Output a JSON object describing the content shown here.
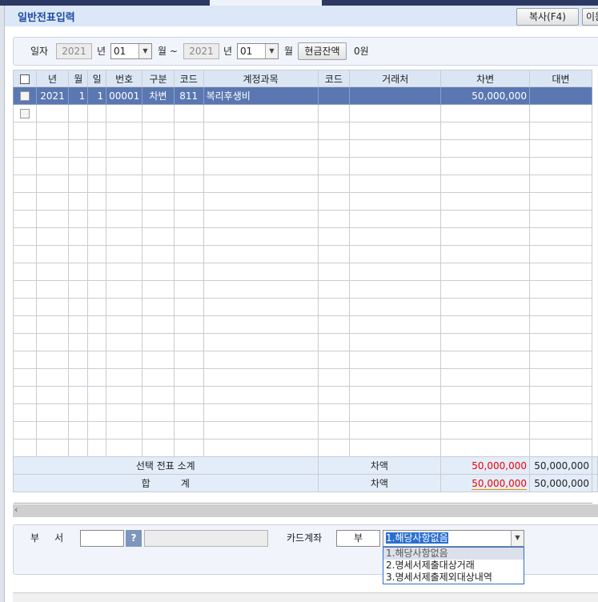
{
  "title": "일반전표입력",
  "toolbar": {
    "copy": "복사(F4)",
    "move": "이동"
  },
  "filter": {
    "date_label": "일자",
    "year_from": "2021",
    "year_unit": "년",
    "month_from": "01",
    "month_unit": "월 ~",
    "year_to": "2021",
    "month_to": "01",
    "month_unit2": "월",
    "cash_button": "현금잔액",
    "cash_value": "0원"
  },
  "grid": {
    "headers": [
      "년",
      "월",
      "일",
      "번호",
      "구분",
      "코드",
      "계정과목",
      "코드",
      "거래처",
      "차변",
      "대변"
    ],
    "rows": [
      [
        "2021",
        "1",
        "1",
        "00001",
        "차변",
        "811",
        "복리후생비",
        "",
        "",
        "50,000,000",
        ""
      ]
    ],
    "summary": [
      {
        "label": "선택 전표 소계",
        "type": "차액",
        "diff": "50,000,000",
        "debit": "50,000,000"
      },
      {
        "label": "합          계",
        "type": "차액",
        "diff": "50,000,000",
        "debit": "50,000,000"
      }
    ]
  },
  "bottom": {
    "dept_label": "부     서",
    "help": "?",
    "card_label": "카드계좌",
    "card_value": "부",
    "dropdown_value": "1.해당사항없음",
    "options": [
      "1.해당사항없음",
      "2.명세서제출대상거래",
      "3.명세서제출제외대상내역"
    ]
  },
  "colors": {
    "selected_row": "#5a77b1",
    "title": "#1f4aa0",
    "diff": "#e00000"
  }
}
